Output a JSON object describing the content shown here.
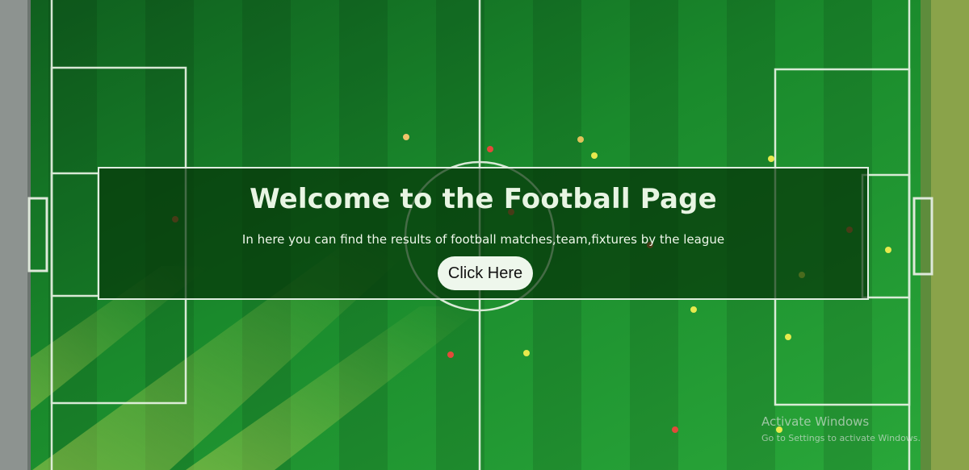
{
  "hero": {
    "title": "Welcome to the Football Page",
    "subtitle": "In here you can find the results of football matches,team,fixtures by the league",
    "button_label": "Click Here"
  },
  "watermark": {
    "title": "Activate Windows",
    "subtitle": "Go to Settings to activate Windows."
  },
  "colors": {
    "pitch_green": "#1f8a2e",
    "panel_overlay": "#063408",
    "panel_border": "#ebf5eb",
    "button_bg": "#eef7ec"
  }
}
